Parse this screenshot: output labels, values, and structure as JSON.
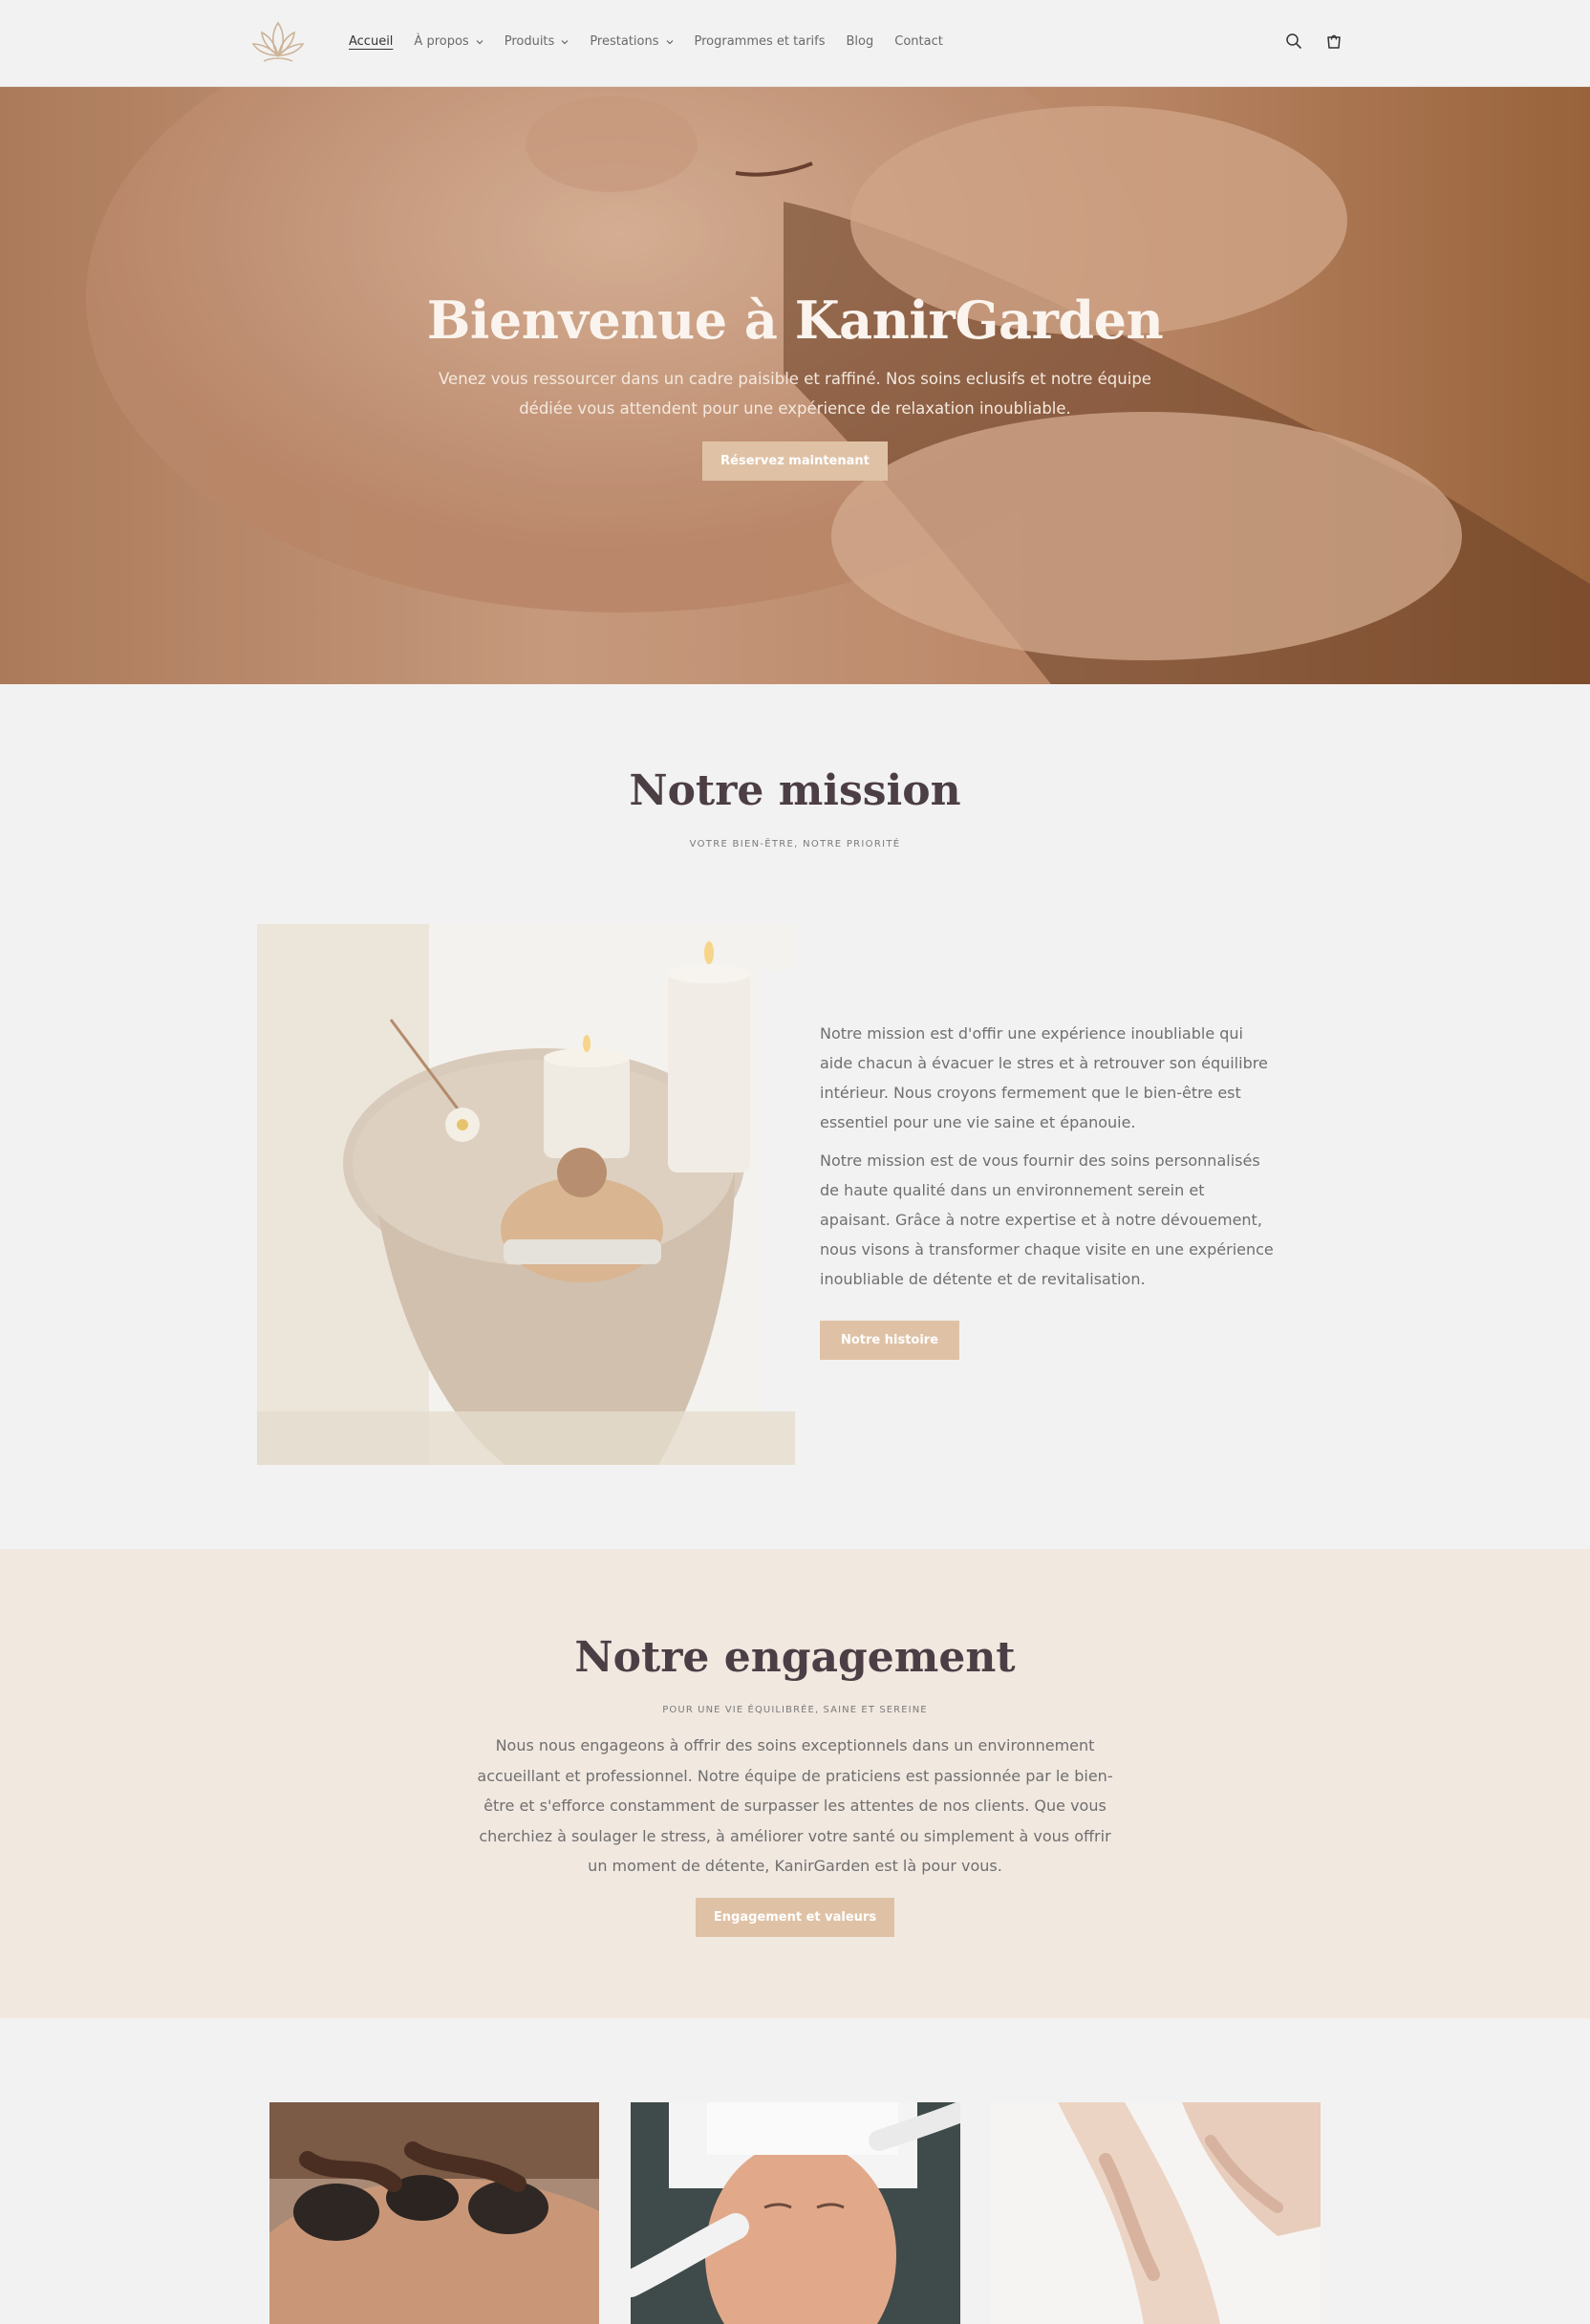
{
  "header": {
    "logo_icon": "lotus-logo-icon",
    "nav": [
      {
        "label": "Accueil",
        "active": true,
        "dropdown": false
      },
      {
        "label": "À propos",
        "active": false,
        "dropdown": true
      },
      {
        "label": "Produits",
        "active": false,
        "dropdown": true
      },
      {
        "label": "Prestations",
        "active": false,
        "dropdown": true
      },
      {
        "label": "Programmes et tarifs",
        "active": false,
        "dropdown": false
      },
      {
        "label": "Blog",
        "active": false,
        "dropdown": false
      },
      {
        "label": "Contact",
        "active": false,
        "dropdown": false
      }
    ],
    "icons": [
      "search-icon",
      "cart-icon"
    ]
  },
  "hero": {
    "title": "Bienvenue à KanirGarden",
    "subtitle": "Venez vous ressourcer dans un cadre paisible et raffiné. Nos soins eclusifs et notre équipe dédiée vous attendent pour une expérience de relaxation inoubliable.",
    "button": "Réservez maintenant"
  },
  "mission": {
    "title": "Notre mission",
    "kicker": "VOTRE BIEN-ÊTRE, NOTRE PRIORITÉ",
    "paragraphs": [
      "Notre mission est d'offir une expérience inoubliable qui aide chacun à évacuer le stres et à retrouver son équilibre intérieur. Nous croyons fermement que le bien-être est essentiel pour une vie saine et épanouie.",
      "Notre mission est de vous fournir des soins personnalisés de haute qualité dans un environnement serein et apaisant. Grâce à notre expertise et à notre dévouement, nous visons à transformer chaque visite en une expérience inoubliable de détente et de revitalisation."
    ],
    "button": "Notre histoire"
  },
  "engagement": {
    "title": "Notre engagement",
    "kicker": "POUR UNE VIE ÉQUILIBRÉE, SAINE ET SEREINE",
    "text": "Nous nous engageons à offrir des soins exceptionnels dans un environnement accueillant et professionnel. Notre équipe de praticiens est passionnée par le bien-être et s'efforce constamment de surpasser les attentes de nos clients. Que vous cherchiez à soulager le stress, à améliorer votre santé ou simplement à vous offrir un moment de détente, KanirGarden est là pour vous.",
    "button": "Engagement et valeurs"
  },
  "colors": {
    "accent": "#dfc2a6",
    "heading": "#4c3e45",
    "page_bg": "#f2f2f2",
    "engage_bg": "#f1e8e0"
  }
}
